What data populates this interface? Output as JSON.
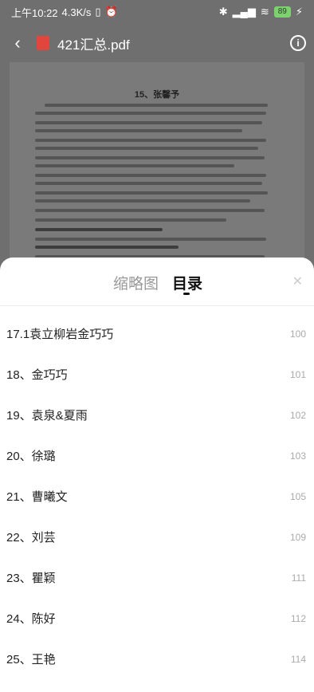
{
  "status": {
    "time": "上午10:22",
    "speed": "4.3K/s",
    "battery": "89"
  },
  "header": {
    "title": "421汇总.pdf"
  },
  "doc_preview": {
    "heading": "15、张馨予"
  },
  "panel": {
    "tab_thumbnails": "缩略图",
    "tab_toc": "目录"
  },
  "toc": [
    {
      "title": "17.1袁立柳岩金巧巧",
      "page": "100"
    },
    {
      "title": "18、金巧巧",
      "page": "101"
    },
    {
      "title": "19、袁泉&夏雨",
      "page": "102"
    },
    {
      "title": "20、徐璐",
      "page": "103"
    },
    {
      "title": "21、曹曦文",
      "page": "105"
    },
    {
      "title": "22、刘芸",
      "page": "109"
    },
    {
      "title": "23、瞿颖",
      "page": "111"
    },
    {
      "title": "24、陈好",
      "page": "112"
    },
    {
      "title": "25、王艳",
      "page": "114"
    }
  ]
}
